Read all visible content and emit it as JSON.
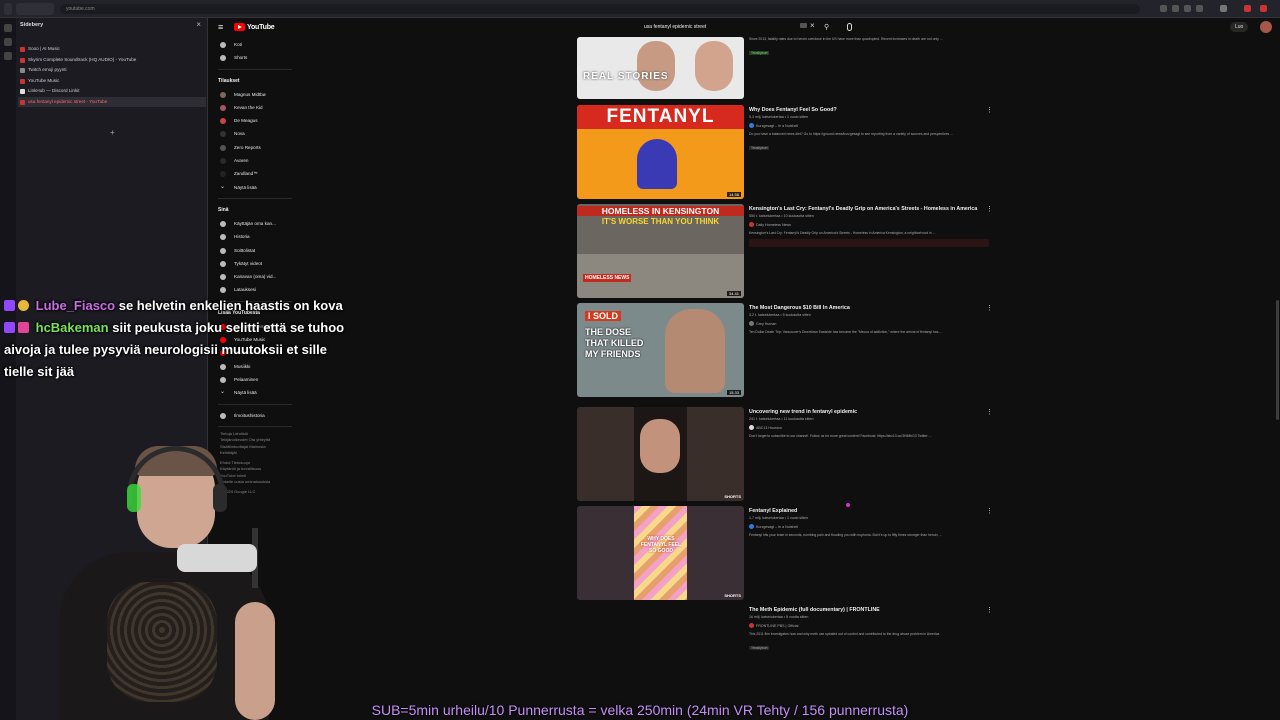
{
  "sideberry": {
    "title": "Sidebery",
    "tabs": [
      {
        "label": "Sooo | AI Music",
        "active": false
      },
      {
        "label": "Skyrim Complete Soundtrack (HQ AUDIO) - YouTube",
        "active": false
      },
      {
        "label": "Twitch emoji pyynti",
        "active": false
      },
      {
        "label": "YouTube Music",
        "active": false
      },
      {
        "label": "LinkHub — Discord Linkit",
        "active": false
      },
      {
        "label": "usa fentanyl epidemic street - YouTube",
        "active": true
      }
    ]
  },
  "youtube": {
    "logo": "YouTube",
    "search_value": "usa fentanyl epidemic street",
    "create_label": "Luo",
    "guide": {
      "top": [
        "Koti",
        "Shorts"
      ],
      "subs_header": "Tilaukset",
      "subs": [
        "Magnus Midtbø",
        "Kevan the Kid",
        "De Meagus",
        "Nova",
        "Zero Reports",
        "Avaren",
        "Zandland™",
        "Näytä lisää"
      ],
      "you_header": "Sinä",
      "you": [
        "Käyttäjän oma kan...",
        "Historia",
        "Soittolistat",
        "Tykätyt videot",
        "Kanavan (oma) vid...",
        "Latauksesi"
      ],
      "more_header": "Lisää YouTubesta",
      "more": [
        "YouTube Premium",
        "YouTube Music",
        "YouTube Kids",
        "Musiikki",
        "Pelaaminen",
        "Näytä lisää"
      ],
      "bottom": [
        "Ilmoitushistoria"
      ],
      "footer": [
        "Tietoja  Lehdistö",
        "Tekijänoikeudet  Ota yhteyttä",
        "Sisällöntuottajat  Mainosta",
        "Kehittäjät",
        "Ehdot  Tietosuoja",
        "Käytäntö ja turvallisuus",
        "YouTube toimii",
        "Kokeile uusia ominaisuuksia",
        "© 2024 Google LLC"
      ]
    },
    "results": [
      {
        "title": "",
        "meta": "",
        "channel": "",
        "desc": "Since 2013, fatality rates due to heroin overdose in the US have more than quadrupled. Recent increases in death are not only ...",
        "badge": "Tekstitykset",
        "thumb": "REAL STORIES",
        "duration": "",
        "kind": "real"
      },
      {
        "title": "Why Does Fentanyl Feel So Good?",
        "meta": "5,3 milj. katselukertaa • 1 vuosi sitten",
        "channel": "Kurzgesagt – In a Nutshell",
        "desc": "Do you have a balanced news diet? Go to https://ground.news/kurzgesagt to see reporting from a variety of sources and perspectives ...",
        "badge": "Tekstitykset",
        "thumb": "FENTANYL",
        "duration": "14.58",
        "kind": "fent"
      },
      {
        "title": "Kensington's Last Cry: Fentanyl's Deadly Grip on America's Streets - Homeless in America",
        "meta": "550 t. katselukertaa • 10 kuukautta sitten",
        "channel": "Daily Homeless News",
        "desc": "Kensington's Last Cry: Fentanyl's Deadly Grip on America's Streets - Homeless in America Kensington, a neighborhood in ...",
        "badge": "",
        "thumb": "HOMELESS IN KENSINGTON",
        "thumb2": "IT'S WORSE THAN YOU THINK",
        "duration": "34.41",
        "kind": "home"
      },
      {
        "title": "The Most Dangerous $10 Bill In America",
        "meta": "3,2 t. katselukertaa • 5 kuukautta sitten",
        "channel": "Grey Human",
        "desc": "Ten Dollar Death Trip: Vancouver's Downtown Eastside has become the \"Mecca of addiction,\" where the arrival of fentanyl has ...",
        "badge": "",
        "thumb": "I SOLD",
        "thumb2": "THE DOSE THAT KILLED MY FRIENDS",
        "duration": "15.33",
        "kind": "sold"
      },
      {
        "title": "Uncovering new trend in fentanyl epidemic",
        "meta": "241 t. katselukertaa • 11 kuukautta sitten",
        "channel": "ABC13 Houston",
        "desc": "Don't forget to subscribe to our channel. Follow us for more great content! Facebook: https://abc13.co/3HIMbG3 Twitter: ...",
        "badge": "",
        "thumb": "",
        "duration": "SHORTS",
        "kind": "short1"
      },
      {
        "title": "Fentanyl Explained",
        "meta": "1,7 milj. katselukertaa • 1 vuosi sitten",
        "channel": "Kurzgesagt – In a Nutshell",
        "desc": "Fentanyl hits your brain in seconds, numbing pain and flooding you with euphoria. But it's up to fifty times stronger than heroin, ...",
        "badge": "",
        "thumb": "WHY DOES FENTANYL FEEL SO GOOD",
        "duration": "SHORTS",
        "kind": "short2"
      },
      {
        "title": "The Meth Epidemic (full documentary) | FRONTLINE",
        "meta": "16 milj. katselukertaa • 5 vuotta sitten",
        "channel": "FRONTLINE PBS | Official",
        "desc": "This 2011 film investigates how and why meth use spiraled out of control and contributed to the drug abuse problem in America.",
        "badge": "Tekstitykset",
        "thumb": "",
        "duration": "",
        "kind": "none"
      }
    ]
  },
  "chat": [
    {
      "user": "Lube_Fiasco",
      "user_color": "#c86ce2",
      "text": "se helvetin enkelien haastis on kova"
    },
    {
      "user": "hcBakeman",
      "user_color": "#78e05b",
      "text": "siit peukusta joku selitti että se tuhoo aivoja ja tulee pysyviä neurologisii muutoksii et sille tielle sit jää"
    }
  ],
  "ticker": "SUB=5min urheilu/10 Punnerrusta = velka 250min (24min VR Tehty / 156 punnerrusta)",
  "colors": {
    "accent": "#ff0000",
    "ticker": "#c38ff7"
  }
}
